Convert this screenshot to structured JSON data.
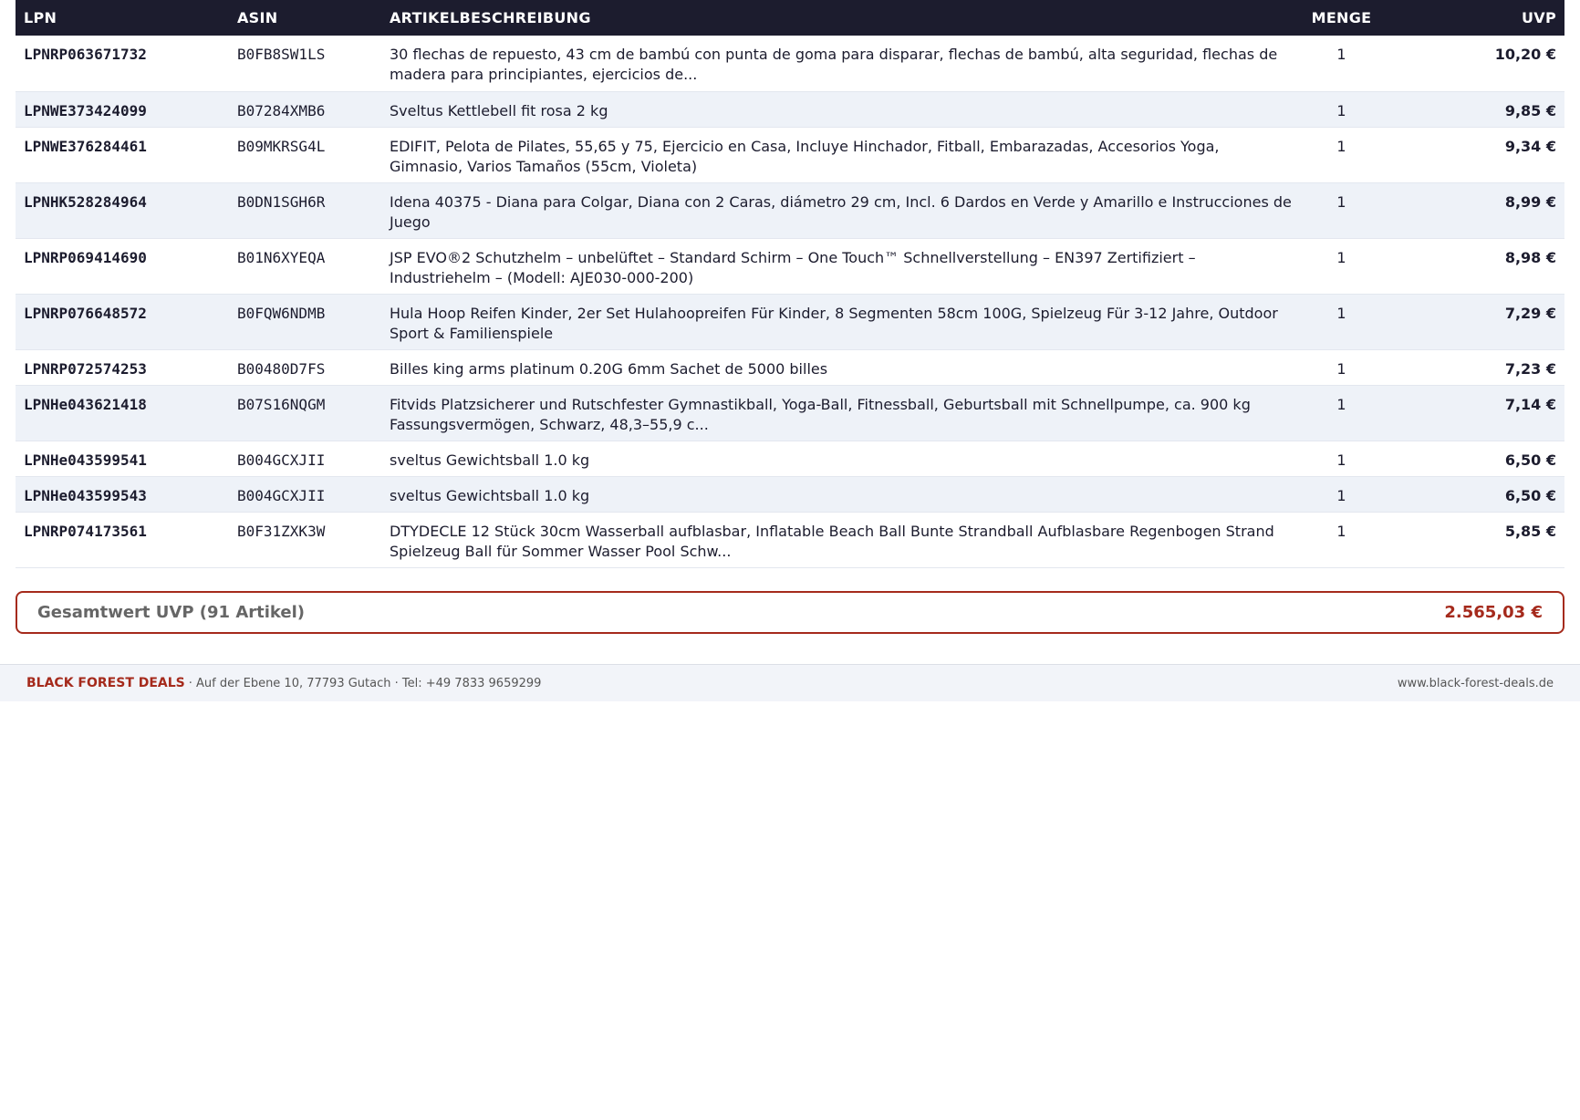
{
  "table": {
    "headers": {
      "lpn": "LPN",
      "asin": "ASIN",
      "description": "ARTIKELBESCHREIBUNG",
      "quantity": "MENGE",
      "uvp": "UVP"
    },
    "rows": [
      {
        "lpn": "LPNRP063671732",
        "asin": "B0FB8SW1LS",
        "description": "30 flechas de repuesto, 43 cm de bambú con punta de goma para disparar, flechas de bambú, alta seguridad, flechas de madera para principiantes, ejercicios de...",
        "quantity": "1",
        "uvp": "10,20 €"
      },
      {
        "lpn": "LPNWE373424099",
        "asin": "B07284XMB6",
        "description": "Sveltus Kettlebell fit rosa 2 kg",
        "quantity": "1",
        "uvp": "9,85 €"
      },
      {
        "lpn": "LPNWE376284461",
        "asin": "B09MKRSG4L",
        "description": "EDIFIT, Pelota de Pilates, 55,65 y 75, Ejercicio en Casa, Incluye Hinchador, Fitball, Embarazadas, Accesorios Yoga, Gimnasio, Varios Tamaños (55cm, Violeta)",
        "quantity": "1",
        "uvp": "9,34 €"
      },
      {
        "lpn": "LPNHK528284964",
        "asin": "B0DN1SGH6R",
        "description": "Idena 40375 - Diana para Colgar, Diana con 2 Caras, diámetro 29 cm, Incl. 6 Dardos en Verde y Amarillo e Instrucciones de Juego",
        "quantity": "1",
        "uvp": "8,99 €"
      },
      {
        "lpn": "LPNRP069414690",
        "asin": "B01N6XYEQA",
        "description": "JSP EVO®2 Schutzhelm – unbelüftet – Standard Schirm – One Touch™ Schnellverstellung – EN397 Zertifiziert – Industriehelm – (Modell: AJE030-000-200)",
        "quantity": "1",
        "uvp": "8,98 €"
      },
      {
        "lpn": "LPNRP076648572",
        "asin": "B0FQW6NDMB",
        "description": "Hula Hoop Reifen Kinder, 2er Set Hulahoopreifen Für Kinder, 8 Segmenten 58cm 100G, Spielzeug Für 3-12 Jahre, Outdoor Sport & Familienspiele",
        "quantity": "1",
        "uvp": "7,29 €"
      },
      {
        "lpn": "LPNRP072574253",
        "asin": "B00480D7FS",
        "description": "Billes king arms platinum 0.20G 6mm Sachet de 5000 billes",
        "quantity": "1",
        "uvp": "7,23 €"
      },
      {
        "lpn": "LPNHe043621418",
        "asin": "B07S16NQGM",
        "description": "Fitvids Platzsicherer und Rutschfester Gymnastikball, Yoga-Ball, Fitnessball, Geburtsball mit Schnellpumpe, ca. 900 kg Fassungsvermögen, Schwarz, 48,3–55,9 c...",
        "quantity": "1",
        "uvp": "7,14 €"
      },
      {
        "lpn": "LPNHe043599541",
        "asin": "B004GCXJII",
        "description": "sveltus Gewichtsball 1.0 kg",
        "quantity": "1",
        "uvp": "6,50 €"
      },
      {
        "lpn": "LPNHe043599543",
        "asin": "B004GCXJII",
        "description": "sveltus Gewichtsball 1.0 kg",
        "quantity": "1",
        "uvp": "6,50 €"
      },
      {
        "lpn": "LPNRP074173561",
        "asin": "B0F31ZXK3W",
        "description": "DTYDECLE 12 Stück 30cm Wasserball aufblasbar, Inflatable Beach Ball Bunte Strandball Aufblasbare Regenbogen Strand Spielzeug Ball für Sommer Wasser Pool Schw...",
        "quantity": "1",
        "uvp": "5,85 €"
      }
    ]
  },
  "total": {
    "label": "Gesamtwert UVP (91 Artikel)",
    "value": "2.565,03 €"
  },
  "footer": {
    "brand": "BLACK FOREST DEALS",
    "address": "· Auf der Ebene 10, 77793 Gutach · Tel: +49 7833 9659299",
    "url": "www.black-forest-deals.de"
  },
  "colors": {
    "header_bg": "#1c1c2e",
    "accent": "#a52a1c",
    "row_alt": "#eef2f8",
    "footer_bg": "#f2f4f9"
  }
}
